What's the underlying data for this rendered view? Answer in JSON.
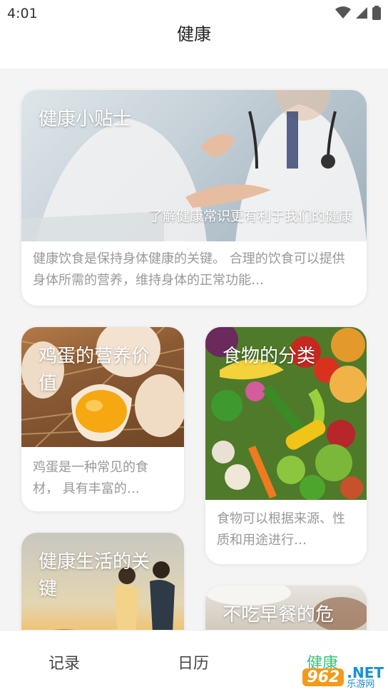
{
  "status_bar": {
    "time": "4:01"
  },
  "app_bar": {
    "title": "健康"
  },
  "cards": [
    {
      "title": "健康小贴士",
      "subtitle": "了解健康常识更有利于我们的健康",
      "description": "健康饮食是保持身体健康的关键。 合理的饮食可以提供身体所需的营养，维持身体的正常功能…"
    },
    {
      "title": "鸡蛋的营养价值",
      "description": "鸡蛋是一种常见的食材， 具有丰富的…"
    },
    {
      "title": "食物的分类",
      "description": "食物可以根据来源、性质和用途进行…"
    },
    {
      "title": "健康生活的关键"
    },
    {
      "title": "不吃早餐的危"
    }
  ],
  "tabs": [
    "记录",
    "日历",
    "健康"
  ],
  "active_tab_color": "#3cc27a",
  "watermark": {
    "logo": "962",
    "net": ".NET",
    "site": "乐游网"
  }
}
